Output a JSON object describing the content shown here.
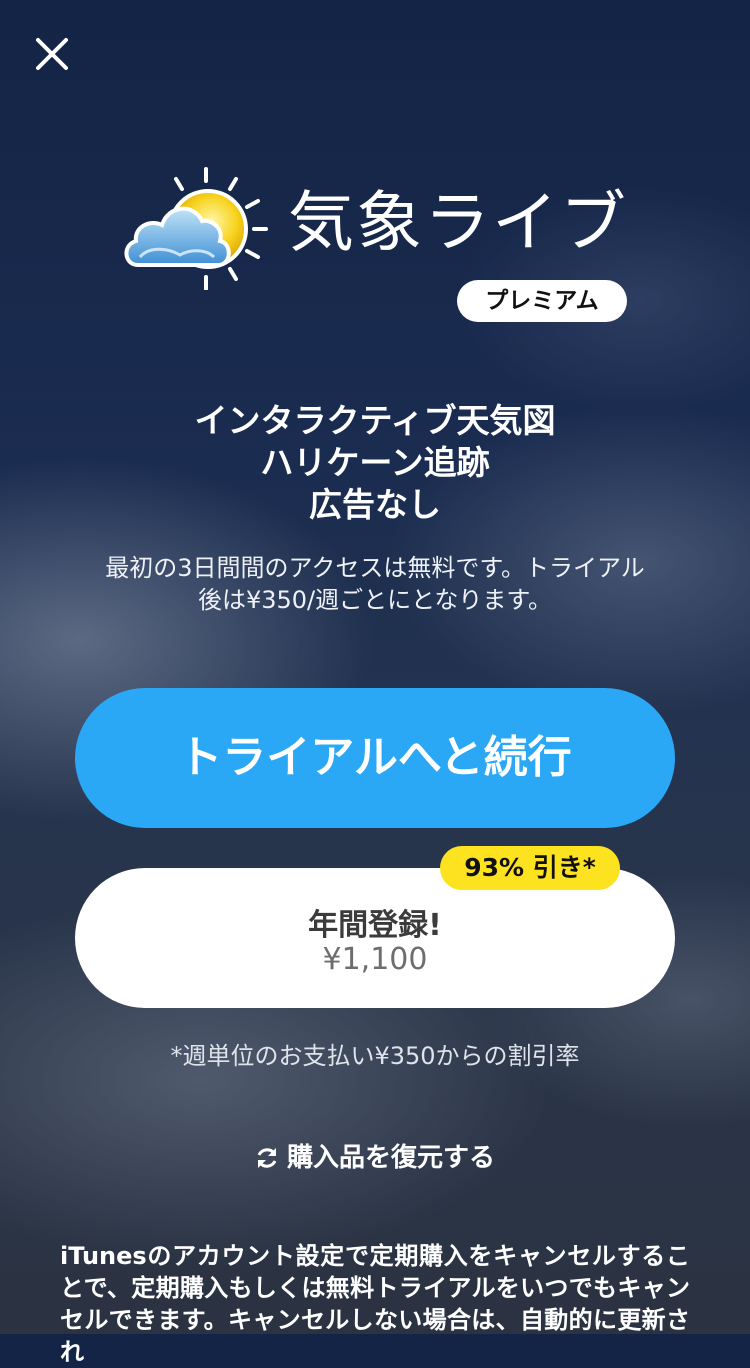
{
  "icons": {
    "close": "close-icon",
    "logo": "weather-sun-cloud-icon",
    "restore": "refresh-icon"
  },
  "colors": {
    "trial_button": "#2aa8f5",
    "discount_badge": "#fde21f",
    "background_top": "#142446",
    "background_bottom": "#2b3342"
  },
  "header": {
    "app_name": "気象ライブ",
    "badge": "プレミアム"
  },
  "features": [
    "インタラクティブ天気図",
    "ハリケーン追跡",
    "広告なし"
  ],
  "description": {
    "line1": "最初の3日間間のアクセスは無料です。トライアル",
    "line2": "後は¥350/週ごとにとなります。"
  },
  "trial_button": {
    "label": "トライアルへと続行"
  },
  "annual": {
    "title": "年間登録!",
    "price": "¥1,100",
    "discount": "93% 引き*"
  },
  "note": "*週単位のお支払い¥350からの割引率",
  "restore": {
    "label": "購入品を復元する"
  },
  "terms": "iTunesのアカウント設定で定期購入をキャンセルすることで、定期購入もしくは無料トライアルをいつでもキャンセルできます。キャンセルしない場合は、自動的に更新され"
}
